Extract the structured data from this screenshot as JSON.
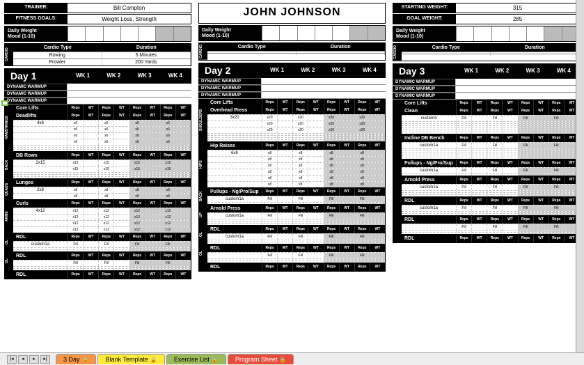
{
  "header": {
    "trainer_label": "Trainer:",
    "trainer_value": "Bill Compton",
    "goals_label": "Fitness Goals:",
    "goals_value": "Weight Loss, Strength",
    "client_name": "John Johnson",
    "start_label": "Starting Weight:",
    "start_value": "315",
    "goal_label": "Goal Weight:",
    "goal_value": "285"
  },
  "daily": {
    "line1": "Daily Weight",
    "line2": "Mood (1-10)"
  },
  "cardio": {
    "side": "CARDIO",
    "type_hdr": "Cardio Type",
    "dur_hdr": "Duration",
    "rows1": [
      {
        "type": "Rowing",
        "dur": "5 Minutes"
      },
      {
        "type": "Prowler",
        "dur": "200 Yards"
      }
    ]
  },
  "weeks": {
    "w1": "WK 1",
    "w2": "WK 2",
    "w3": "WK 3",
    "w4": "WK 4"
  },
  "rw": {
    "reps": "Reps",
    "wt": "WT"
  },
  "warmup": "Dynamic Warmup",
  "core_lifts": "Core Lifts",
  "day1": {
    "title": "Day 1",
    "sections": [
      {
        "side": "HAMSTRINGS",
        "hdr": "Deadlifts",
        "rows": [
          {
            "name": "4x6",
            "r": "x6"
          },
          {
            "name": "",
            "r": "x6"
          },
          {
            "name": "",
            "r": "x6"
          },
          {
            "name": "",
            "r": "x6"
          },
          {
            "name": "",
            "r": ""
          },
          {
            "name": "",
            "r": ""
          },
          {
            "name": "",
            "r": ""
          }
        ]
      },
      {
        "side": "BACK",
        "hdr": "DB Rows",
        "rows": [
          {
            "name": "2x15",
            "r": "x15"
          },
          {
            "name": "",
            "r": "x15"
          },
          {
            "name": "",
            "r": ""
          },
          {
            "name": "",
            "r": ""
          },
          {
            "name": "",
            "r": ""
          }
        ]
      },
      {
        "side": "QUADS",
        "hdr": "Lunges",
        "rows": [
          {
            "name": "2x8",
            "r": "x8"
          },
          {
            "name": "",
            "r": "x8"
          }
        ]
      },
      {
        "side": "ARMS",
        "hdr": "Curls",
        "rows": [
          {
            "name": "4x12",
            "r": "x12"
          },
          {
            "name": "",
            "r": "x12"
          },
          {
            "name": "",
            "r": "x12"
          },
          {
            "name": "",
            "r": "x12"
          }
        ]
      },
      {
        "side": "OL",
        "hdr": "RDL",
        "rows": [
          {
            "name": "custom1a",
            "r": "Fill"
          },
          {
            "name": "",
            "r": ""
          },
          {
            "name": "",
            "r": ""
          }
        ]
      },
      {
        "side": "OL",
        "hdr": "RDL",
        "rows": [
          {
            "name": "",
            "r": "Fill"
          },
          {
            "name": "",
            "r": ""
          },
          {
            "name": "",
            "r": ""
          }
        ]
      },
      {
        "side": "",
        "hdr": "RDL",
        "rows": []
      }
    ]
  },
  "day2": {
    "title": "Day 2",
    "sections": [
      {
        "side": "SHOULDERS",
        "hdr": "Overhead Press",
        "rows": [
          {
            "name": "3x20",
            "r": "x20"
          },
          {
            "name": "",
            "r": "x20"
          },
          {
            "name": "",
            "r": "x20"
          },
          {
            "name": "",
            "r": ""
          },
          {
            "name": "",
            "r": ""
          },
          {
            "name": "",
            "r": ""
          },
          {
            "name": "",
            "r": ""
          }
        ]
      },
      {
        "side": "HIPS",
        "hdr": "Hip Raises",
        "rows": [
          {
            "name": "6x8",
            "r": "x8"
          },
          {
            "name": "",
            "r": "x8"
          },
          {
            "name": "",
            "r": "x8"
          },
          {
            "name": "",
            "r": "x8"
          },
          {
            "name": "",
            "r": "x8"
          },
          {
            "name": "",
            "r": "x8"
          }
        ]
      },
      {
        "side": "BACK",
        "hdr": "Pullups - ng/pro/sup",
        "rows": [
          {
            "name": "custom1a",
            "r": "Fill"
          },
          {
            "name": "",
            "r": ""
          }
        ]
      },
      {
        "side": "UP",
        "hdr": "Arnold Press",
        "rows": [
          {
            "name": "custom1a",
            "r": "Fill"
          },
          {
            "name": "",
            "r": ""
          },
          {
            "name": "",
            "r": ""
          },
          {
            "name": "",
            "r": ""
          }
        ]
      },
      {
        "side": "OL",
        "hdr": "RDL",
        "rows": [
          {
            "name": "custom1a",
            "r": "Fill"
          },
          {
            "name": "",
            "r": ""
          },
          {
            "name": "",
            "r": ""
          }
        ]
      },
      {
        "side": "OL",
        "hdr": "RDL",
        "rows": [
          {
            "name": "",
            "r": "Fill"
          },
          {
            "name": "",
            "r": ""
          },
          {
            "name": "",
            "r": ""
          }
        ]
      },
      {
        "side": "",
        "hdr": "RDL",
        "rows": []
      }
    ]
  },
  "day3": {
    "title": "Day 3",
    "sections": [
      {
        "side": "",
        "hdr": "Clean",
        "rows": [
          {
            "name": "custom4",
            "r": "Fill"
          },
          {
            "name": "",
            "r": ""
          },
          {
            "name": "",
            "r": ""
          },
          {
            "name": "",
            "r": ""
          },
          {
            "name": "",
            "r": ""
          },
          {
            "name": "",
            "r": ""
          },
          {
            "name": "",
            "r": ""
          }
        ]
      },
      {
        "side": "",
        "hdr": "Incline DB Bench",
        "rows": [
          {
            "name": "custom1a",
            "r": "Fill"
          },
          {
            "name": "",
            "r": ""
          },
          {
            "name": "",
            "r": ""
          },
          {
            "name": "",
            "r": ""
          },
          {
            "name": "",
            "r": ""
          },
          {
            "name": "",
            "r": ""
          }
        ]
      },
      {
        "side": "",
        "hdr": "Pullups - ng/pro/sup",
        "rows": [
          {
            "name": "custom1a",
            "r": "Fill"
          },
          {
            "name": "",
            "r": ""
          }
        ]
      },
      {
        "side": "",
        "hdr": "Arnold Press",
        "rows": [
          {
            "name": "custom1a",
            "r": "Fill"
          },
          {
            "name": "",
            "r": ""
          },
          {
            "name": "",
            "r": ""
          },
          {
            "name": "",
            "r": ""
          }
        ]
      },
      {
        "side": "",
        "hdr": "RDL",
        "rows": [
          {
            "name": "custom1a",
            "r": "Fill"
          },
          {
            "name": "",
            "r": ""
          },
          {
            "name": "",
            "r": ""
          }
        ]
      },
      {
        "side": "",
        "hdr": "RDL",
        "rows": [
          {
            "name": "",
            "r": "Fill"
          },
          {
            "name": "",
            "r": ""
          },
          {
            "name": "",
            "r": ""
          }
        ]
      },
      {
        "side": "",
        "hdr": "RDL",
        "rows": []
      }
    ]
  },
  "tabs": {
    "t1": "3 Day",
    "t2": "Blank Template",
    "t3": "Exercise List",
    "t4": "Program Sheet",
    "lock": "🔒"
  }
}
